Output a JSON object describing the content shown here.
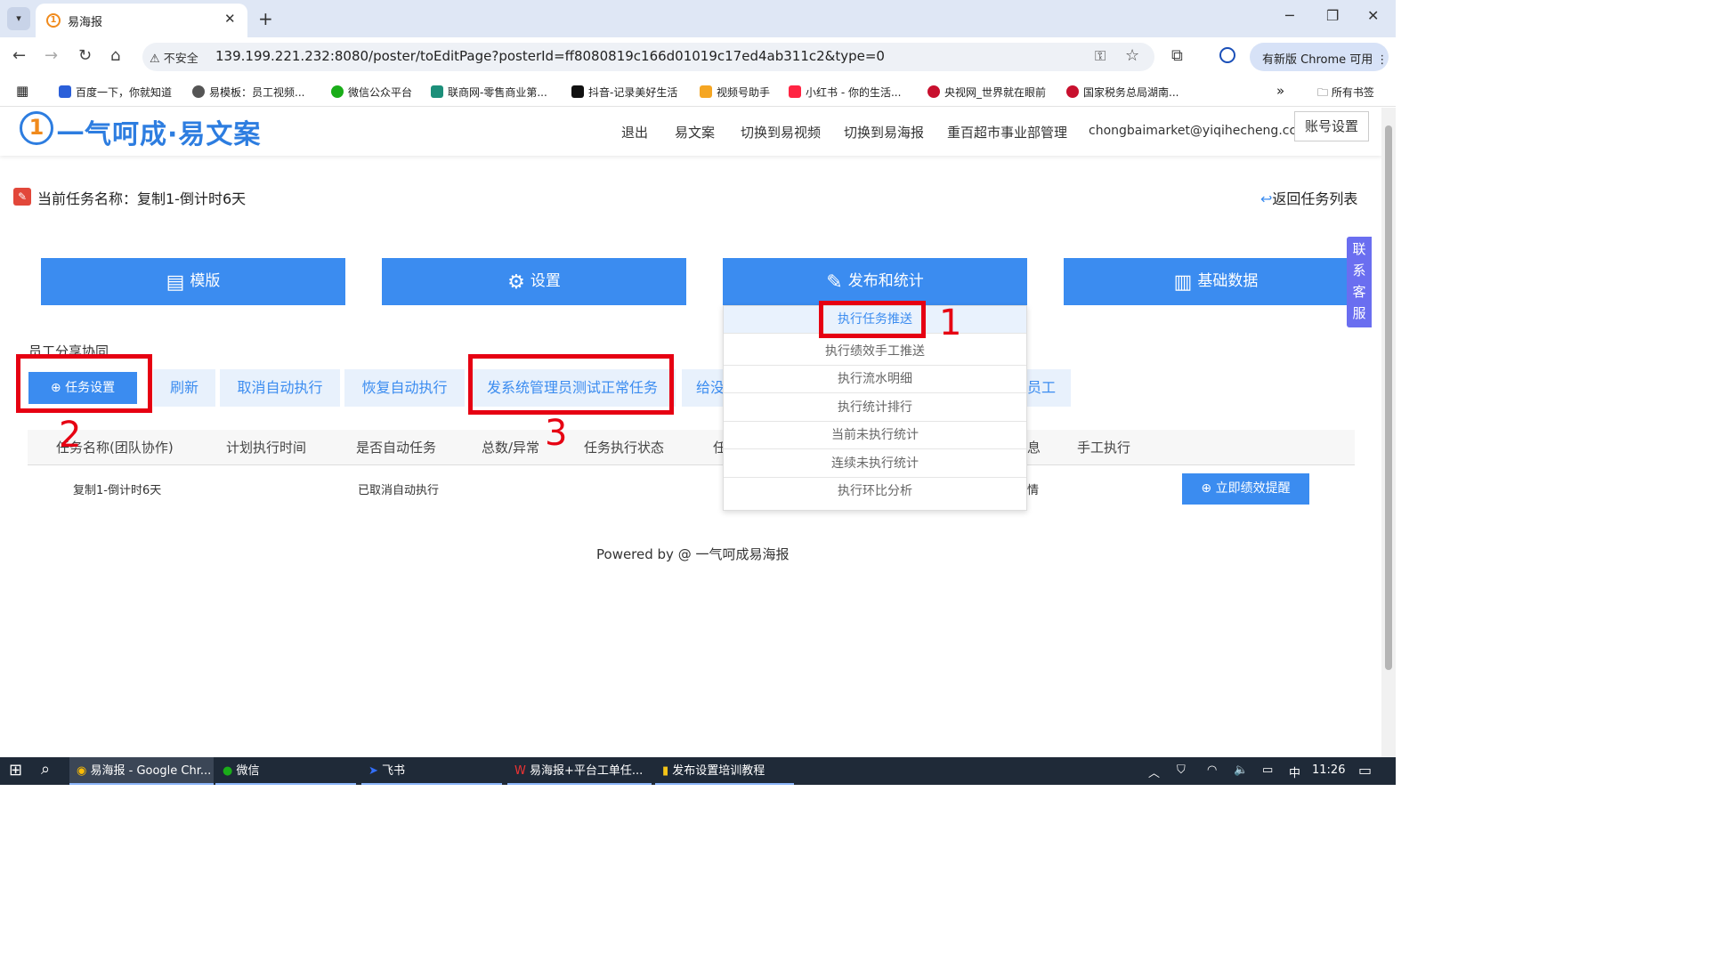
{
  "browser": {
    "tab_title": "易海报",
    "tab_close": "✕",
    "new_tab": "+",
    "insecure_label": "不安全",
    "url": "139.199.221.232:8080/poster/toEditPage?posterId=ff8080819c166d01019c17ed4ab311c2&type=0",
    "update_label": "有新版 Chrome 可用",
    "bookmarks": [
      {
        "label": "百度一下，你就知道",
        "color": "#2b5fd9"
      },
      {
        "label": "易模板：员工视频...",
        "color": "#555555"
      },
      {
        "label": "微信公众平台",
        "color": "#1aad19"
      },
      {
        "label": "联商网-零售商业第...",
        "color": "#1c8f7a"
      },
      {
        "label": "抖音-记录美好生活",
        "color": "#111111"
      },
      {
        "label": "视频号助手",
        "color": "#f5a623"
      },
      {
        "label": "小红书 - 你的生活...",
        "color": "#ff2442"
      },
      {
        "label": "央视网_世界就在眼前",
        "color": "#c8102e"
      },
      {
        "label": "国家税务总局湖南...",
        "color": "#c8102e"
      }
    ],
    "more_bookmarks": "»",
    "all_bookmarks": "所有书签"
  },
  "site": {
    "logo_mark": "1",
    "logo_text": "一气呵成·易文案",
    "nav": [
      "退出",
      "易文案",
      "切换到易视频",
      "切换到易海报",
      "重百超市事业部管理",
      "chongbaimarket@yiqihecheng.cc"
    ],
    "account_button": "账号设置"
  },
  "task": {
    "current_name": "当前任务名称：复制1-倒计时6天",
    "back_link": "返回任务列表"
  },
  "main_buttons": [
    {
      "label": "模版",
      "icon": "template-icon"
    },
    {
      "label": "设置",
      "icon": "gear-icon"
    },
    {
      "label": "发布和统计",
      "icon": "edit-icon"
    },
    {
      "label": "基础数据",
      "icon": "data-report-icon"
    }
  ],
  "contact": "联系客服",
  "collab_label": "员工分享协同",
  "toolbar": {
    "task_setting": "任务设置",
    "refresh": "刷新",
    "cancel_auto": "取消自动执行",
    "resume_auto": "恢复自动执行",
    "send_test": "发系统管理员测试正常任务",
    "give_partial": "给没",
    "staff_partial": "员工"
  },
  "table": {
    "headers": [
      "任务名称(团队协作)",
      "计划执行时间",
      "是否自动任务",
      "总数/异常",
      "任务执行状态",
      "任",
      "息",
      "手工执行"
    ],
    "row": {
      "name": "复制1-倒计时6天",
      "auto": "已取消自动执行",
      "detail_partial": "情",
      "remind_button": "立即绩效提醒"
    }
  },
  "dropdown": [
    "执行任务推送",
    "执行绩效手工推送",
    "执行流水明细",
    "执行统计排行",
    "当前未执行统计",
    "连续未执行统计",
    "执行环比分析"
  ],
  "annotations": [
    "1",
    "2",
    "3"
  ],
  "footer": "Powered by @ 一气呵成易海报",
  "taskbar": {
    "apps": [
      "易海报 - Google Chr...",
      "微信",
      "飞书",
      "易海报+平台工单任...",
      "发布设置培训教程"
    ],
    "ime": "中",
    "time": "11:26"
  },
  "colors": {
    "primary": "#3b8cf0",
    "annotation_red": "#e60012",
    "contact_purple": "#6a6ef0"
  }
}
